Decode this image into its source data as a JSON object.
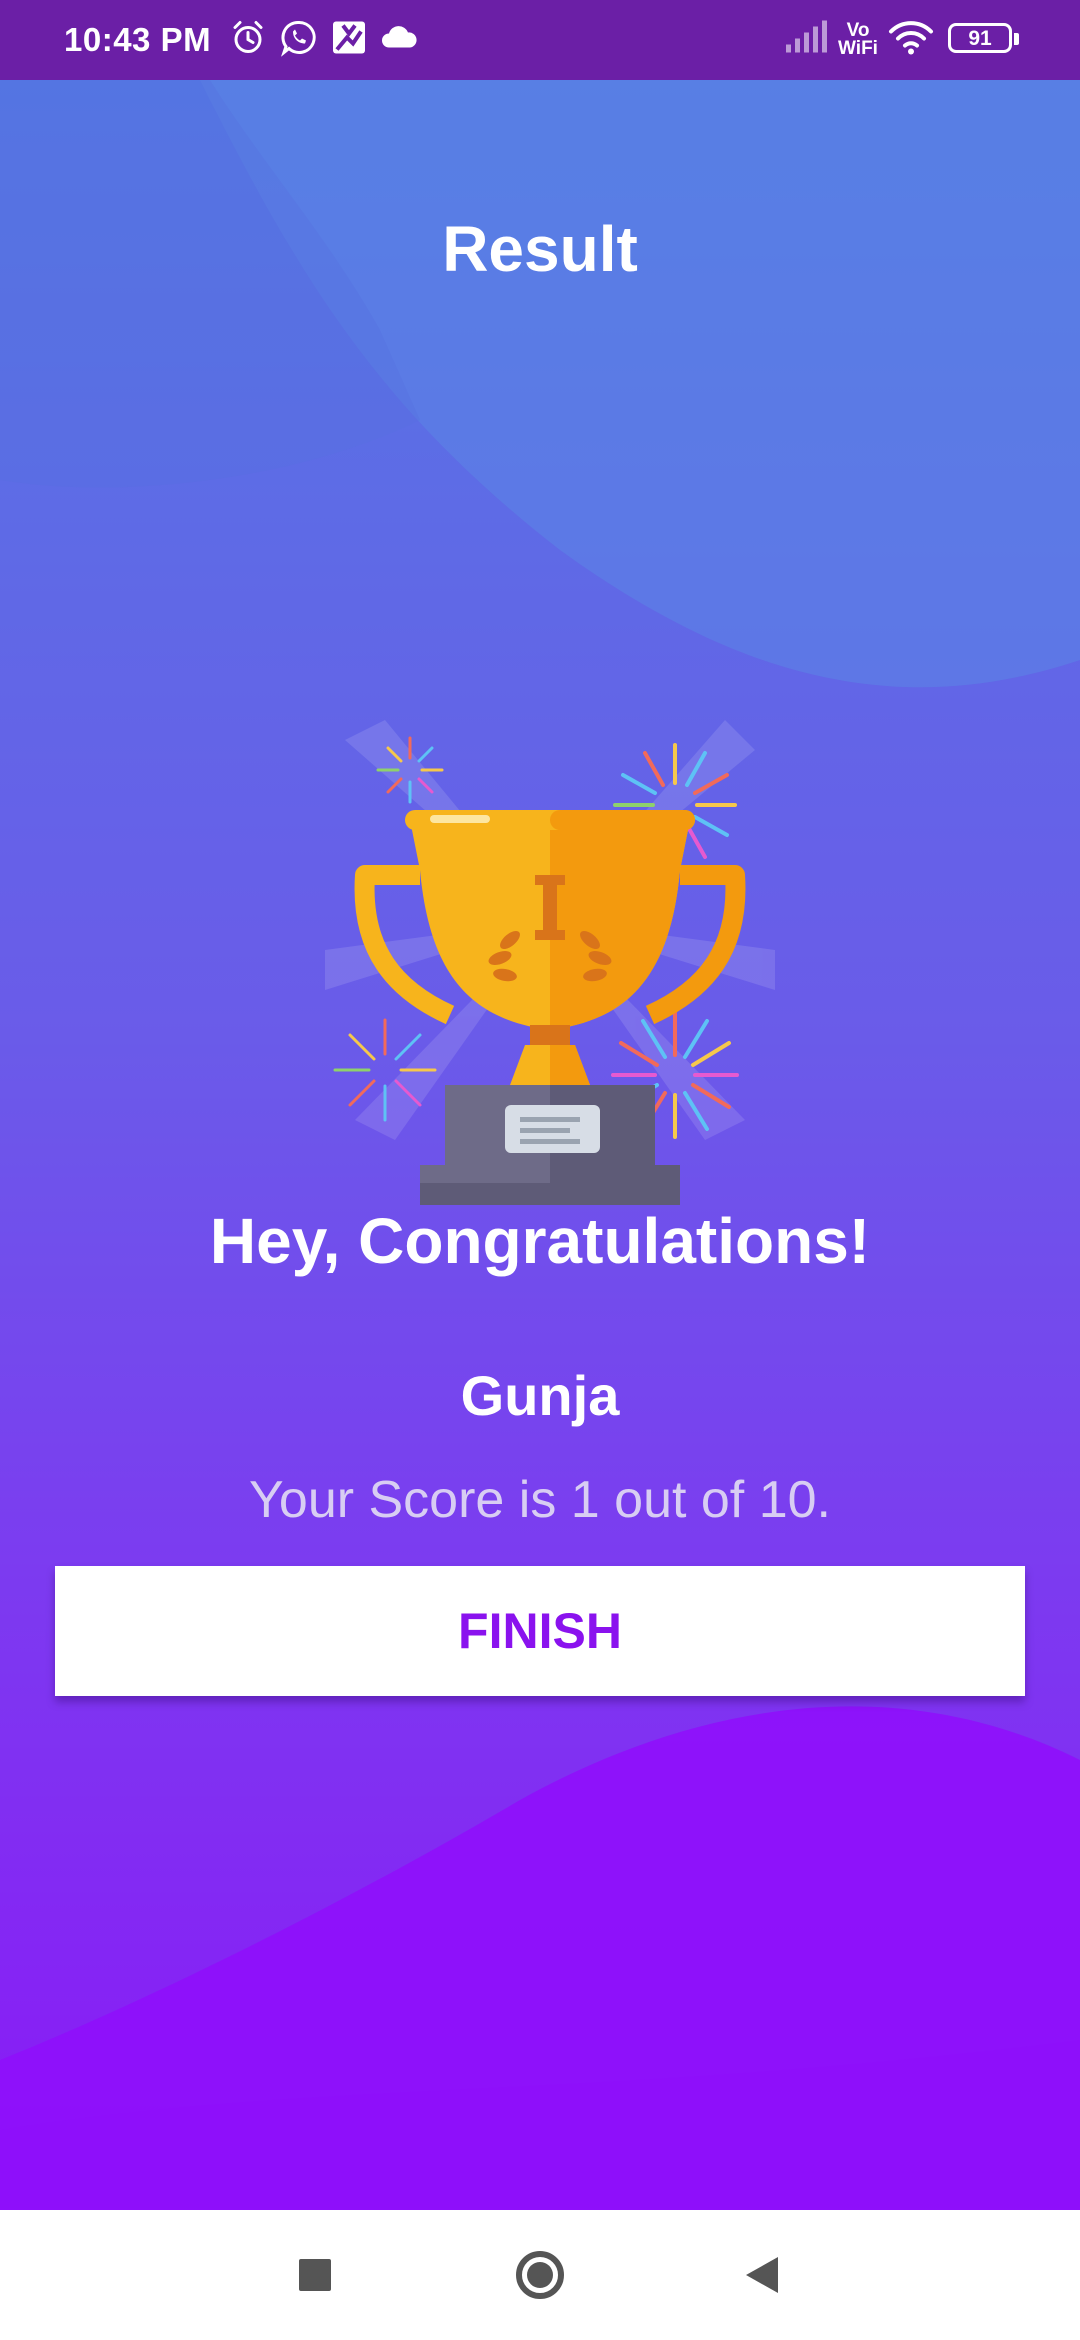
{
  "status_bar": {
    "time": "10:43 PM",
    "battery": "91",
    "network_label_top": "Vo",
    "network_label_bottom": "WiFi",
    "icons": [
      "alarm-icon",
      "whatsapp-icon",
      "gallery-icon",
      "cloud-icon",
      "signal-icon",
      "vowifi-icon",
      "wifi-icon",
      "battery-icon"
    ]
  },
  "header": {
    "title": "Result"
  },
  "result": {
    "congrats": "Hey, Congratulations!",
    "name": "Gunja",
    "score_text": "Your Score is 1 out of 10."
  },
  "actions": {
    "finish_label": "FINISH"
  },
  "nav_bar": {
    "icons": [
      "recents-icon",
      "home-icon",
      "back-icon"
    ]
  },
  "colors": {
    "status_bar": "#6b1fa6",
    "gradient_top": "#5478e3",
    "gradient_bottom": "#8a18f6",
    "finish_text": "#8a12ee",
    "trophy_gold": "#f7b41c",
    "trophy_base": "#5e5b77"
  }
}
